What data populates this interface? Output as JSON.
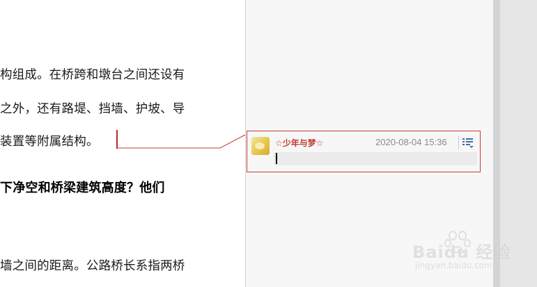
{
  "document": {
    "lines": [
      "构组成。在桥跨和墩台之间还设有",
      "之外，还有路堤、挡墙、护坡、导",
      "装置等附属结构。",
      "下净空和桥梁建筑高度？他们",
      "墙之间的距离。公路桥长系指两桥"
    ]
  },
  "comment": {
    "author": "☆少年与梦☆",
    "timestamp": "2020-08-04 15:36",
    "input_value": ""
  },
  "watermark": {
    "brand": "Baidu 经验",
    "url": "jingyan.baidu.com"
  },
  "icons": {
    "menu": "list-menu-icon",
    "avatar": "avatar-image",
    "paw": "baidu-paw-icon"
  },
  "colors": {
    "comment_accent": "#c43b3b",
    "author": "#c0392b",
    "menu_icon": "#3b6ea8",
    "pane_bg": "#f7f7f7"
  }
}
